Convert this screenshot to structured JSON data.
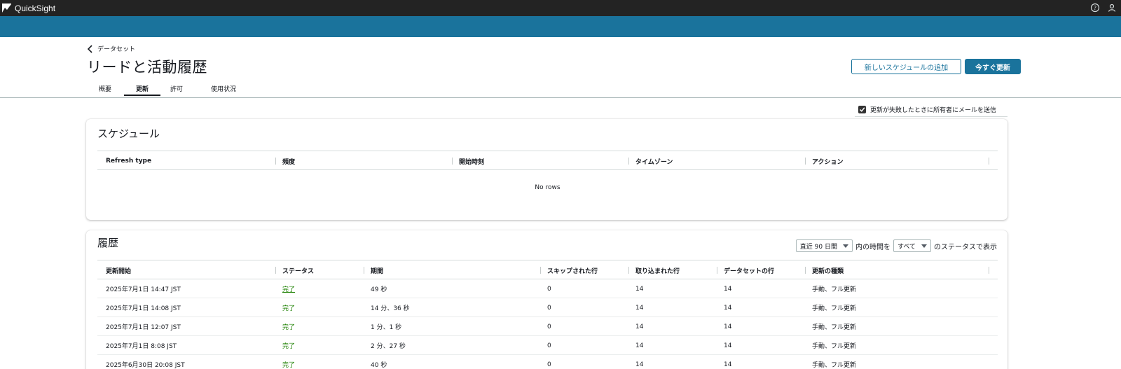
{
  "app": {
    "name": "QuickSight"
  },
  "top_icons": {
    "help": "help-icon",
    "user": "user-icon"
  },
  "breadcrumb": {
    "label": "データセット"
  },
  "page": {
    "title": "リードと活動履歴"
  },
  "actions": {
    "add_schedule": "新しいスケジュールの追加",
    "refresh_now": "今すぐ更新"
  },
  "tabs": [
    {
      "label": "概要",
      "active": false
    },
    {
      "label": "更新",
      "active": true
    },
    {
      "label": "許可",
      "active": false
    },
    {
      "label": "使用状況",
      "active": false
    }
  ],
  "notify": {
    "label": "更新が失敗したときに所有者にメールを送信",
    "checked": true
  },
  "schedule": {
    "title": "スケジュール",
    "columns": [
      "Refresh type",
      "頻度",
      "開始時刻",
      "タイムゾーン",
      "アクション"
    ],
    "empty_text": "No rows"
  },
  "history": {
    "title": "履歴",
    "range_select": "直近 90 日間",
    "mid_text": "内の時間を",
    "status_select": "すべて",
    "end_text": "のステータスで表示",
    "columns": [
      "更新開始",
      "ステータス",
      "期間",
      "スキップされた行",
      "取り込まれた行",
      "データセットの行",
      "更新の種類"
    ],
    "rows": [
      [
        "2025年7月1日 14:47 JST",
        "完了",
        "49 秒",
        "0",
        "14",
        "14",
        "手動、フル更新"
      ],
      [
        "2025年7月1日 14:08 JST",
        "完了",
        "14 分、36 秒",
        "0",
        "14",
        "14",
        "手動、フル更新"
      ],
      [
        "2025年7月1日 12:07 JST",
        "完了",
        "1 分、1 秒",
        "0",
        "14",
        "14",
        "手動、フル更新"
      ],
      [
        "2025年7月1日 8:08 JST",
        "完了",
        "2 分、27 秒",
        "0",
        "14",
        "14",
        "手動、フル更新"
      ],
      [
        "2025年6月30日 20:08 JST",
        "完了",
        "40 秒",
        "0",
        "14",
        "14",
        "手動、フル更新"
      ]
    ]
  },
  "colors": {
    "topbar": "#232323",
    "brand_blue": "#1a739c",
    "success": "#1d8102"
  }
}
